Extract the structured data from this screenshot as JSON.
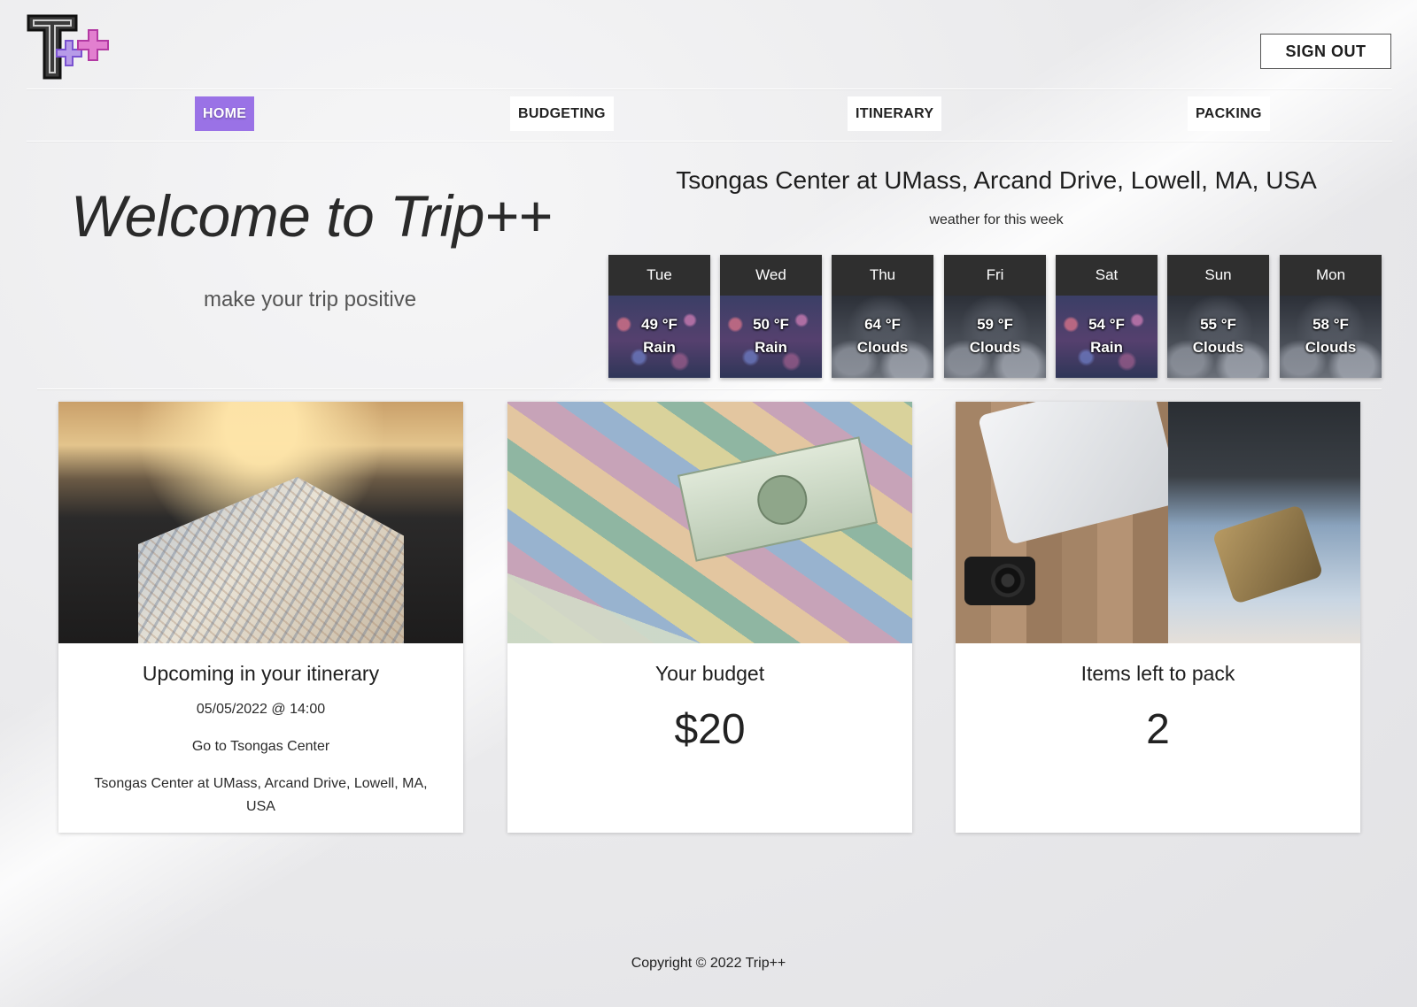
{
  "header": {
    "logo_alt": "T++",
    "sign_out_label": "SIGN OUT"
  },
  "nav": {
    "home": "HOME",
    "budgeting": "BUDGETING",
    "itinerary": "ITINERARY",
    "packing": "PACKING"
  },
  "hero": {
    "welcome": "Welcome to Trip++",
    "tagline": "make your trip positive"
  },
  "weather": {
    "location": "Tsongas Center at UMass, Arcand Drive, Lowell, MA, USA",
    "subtitle": "weather for this week",
    "days": [
      {
        "day": "Tue",
        "temp": "49 °F",
        "condition": "Rain"
      },
      {
        "day": "Wed",
        "temp": "50 °F",
        "condition": "Rain"
      },
      {
        "day": "Thu",
        "temp": "64 °F",
        "condition": "Clouds"
      },
      {
        "day": "Fri",
        "temp": "59 °F",
        "condition": "Clouds"
      },
      {
        "day": "Sat",
        "temp": "54 °F",
        "condition": "Rain"
      },
      {
        "day": "Sun",
        "temp": "55 °F",
        "condition": "Clouds"
      },
      {
        "day": "Mon",
        "temp": "58 °F",
        "condition": "Clouds"
      }
    ]
  },
  "cards": {
    "itinerary": {
      "title": "Upcoming in your itinerary",
      "datetime": "05/05/2022 @ 14:00",
      "event": "Go to Tsongas Center",
      "location": "Tsongas Center at UMass, Arcand Drive, Lowell, MA, USA"
    },
    "budget": {
      "title": "Your budget",
      "amount": "$20"
    },
    "packing": {
      "title": "Items left to pack",
      "count": "2"
    }
  },
  "footer": {
    "copyright": "Copyright © 2022 Trip++"
  },
  "colors": {
    "accent": "#9a72e6",
    "weather_header": "#2f2f2f"
  }
}
